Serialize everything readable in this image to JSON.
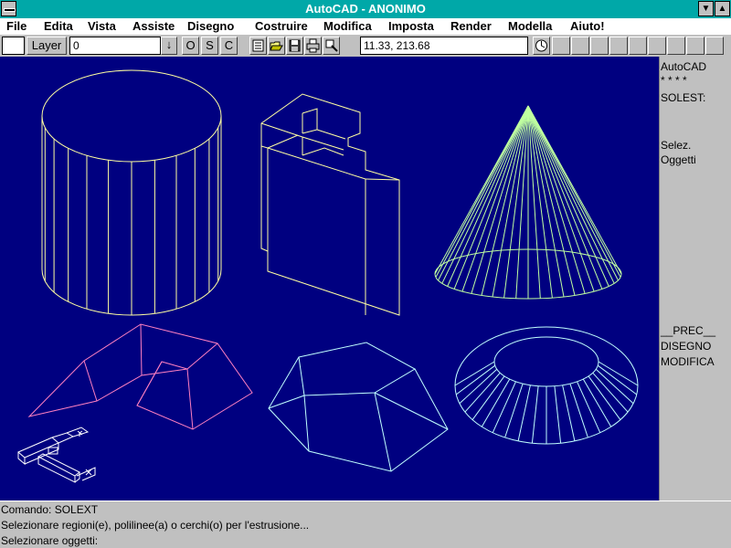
{
  "window": {
    "title": "AutoCAD - ANONIMO"
  },
  "menu": [
    "File",
    "Edita",
    "Vista",
    "Assiste",
    "Disegno",
    "Costruire",
    "Modifica",
    "Imposta",
    "Render",
    "Modella",
    "Aiuto!"
  ],
  "toolbar": {
    "layer_button": "Layer",
    "layer_value": "0",
    "ortho_label": "O",
    "snap_label": "S",
    "coords_label": "C",
    "coordinates": "11.33, 213.68"
  },
  "side_menu": {
    "header": "AutoCAD",
    "stars": "* * * *",
    "solest": "SOLEST:",
    "selez": "Selez.",
    "oggetti": "Oggetti",
    "prec": "__PREC__",
    "disegno": "DISEGNO",
    "modifica": "MODIFICA"
  },
  "command_lines": [
    "Comando: SOLEXT",
    "Selezionare regioni(e), polilinee(a) o cerchi(o) per l'estrusione...",
    "Selezionare oggetti:"
  ],
  "colors": {
    "titlebar": "#00a8a8",
    "canvas": "#000080",
    "cylinder": "#ffffa0",
    "cone": "#c0ffa0",
    "prism": "#ff80c0",
    "frustum": "#c0ffff"
  },
  "icons": [
    "system-menu-icon",
    "minimize-icon",
    "maximize-icon",
    "dropdown-arrow-icon",
    "new-file-icon",
    "open-file-icon",
    "save-icon",
    "print-icon",
    "preview-icon",
    "undo-icon"
  ]
}
